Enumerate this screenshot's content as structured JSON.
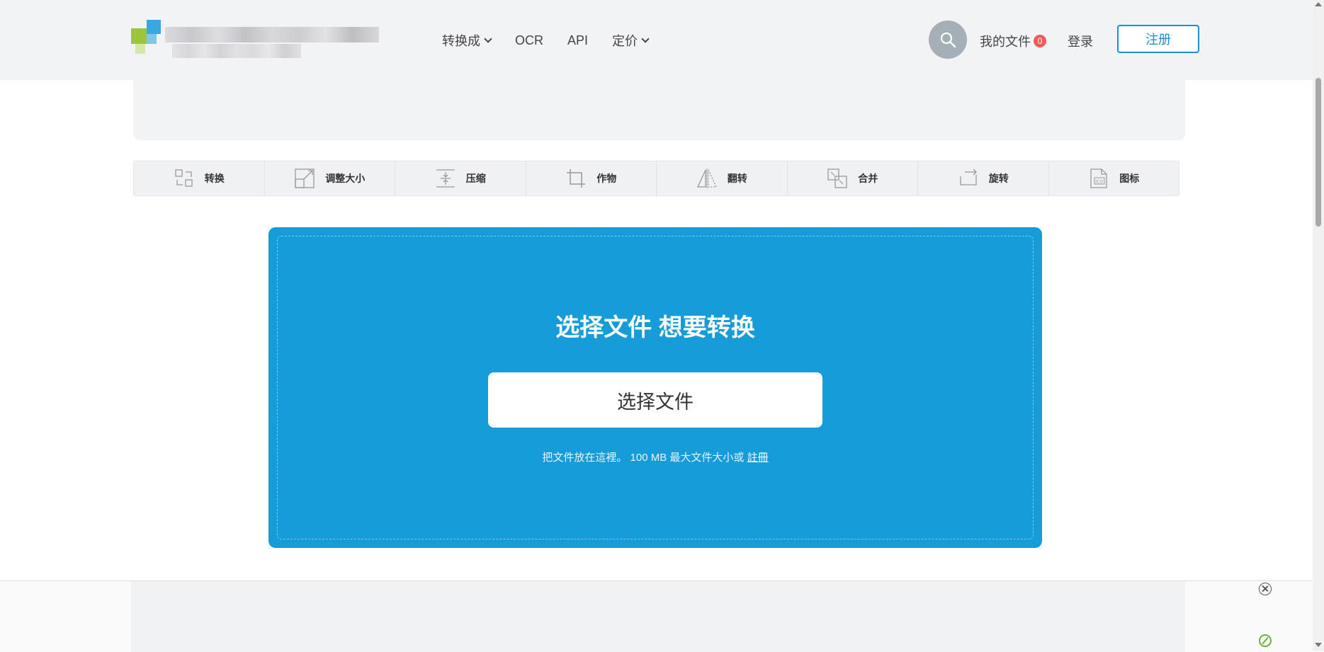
{
  "header": {
    "nav": [
      {
        "label": "转换成",
        "dropdown": true
      },
      {
        "label": "OCR",
        "dropdown": false
      },
      {
        "label": "API",
        "dropdown": false
      },
      {
        "label": "定价",
        "dropdown": true
      }
    ],
    "search_icon": "search-icon",
    "my_files_label": "我的文件",
    "my_files_count": "0",
    "login_label": "登录",
    "register_label": "注册"
  },
  "tools": [
    {
      "label": "转换",
      "icon": "convert-icon"
    },
    {
      "label": "调整大小",
      "icon": "resize-icon"
    },
    {
      "label": "压缩",
      "icon": "compress-icon"
    },
    {
      "label": "作物",
      "icon": "crop-icon"
    },
    {
      "label": "翻转",
      "icon": "flip-icon"
    },
    {
      "label": "合并",
      "icon": "merge-icon"
    },
    {
      "label": "旋转",
      "icon": "rotate-icon"
    },
    {
      "label": "图标",
      "icon": "ico-icon"
    }
  ],
  "upload": {
    "title": "选择文件 想要转换",
    "button_label": "选择文件",
    "hint_text": "把文件放在這裡。 100 MB 最大文件大小或",
    "hint_link": "註冊"
  },
  "colors": {
    "accent": "#159cd9",
    "register_border": "#1a8fd1",
    "badge": "#f25b5b",
    "header_bg": "#f2f3f5"
  }
}
